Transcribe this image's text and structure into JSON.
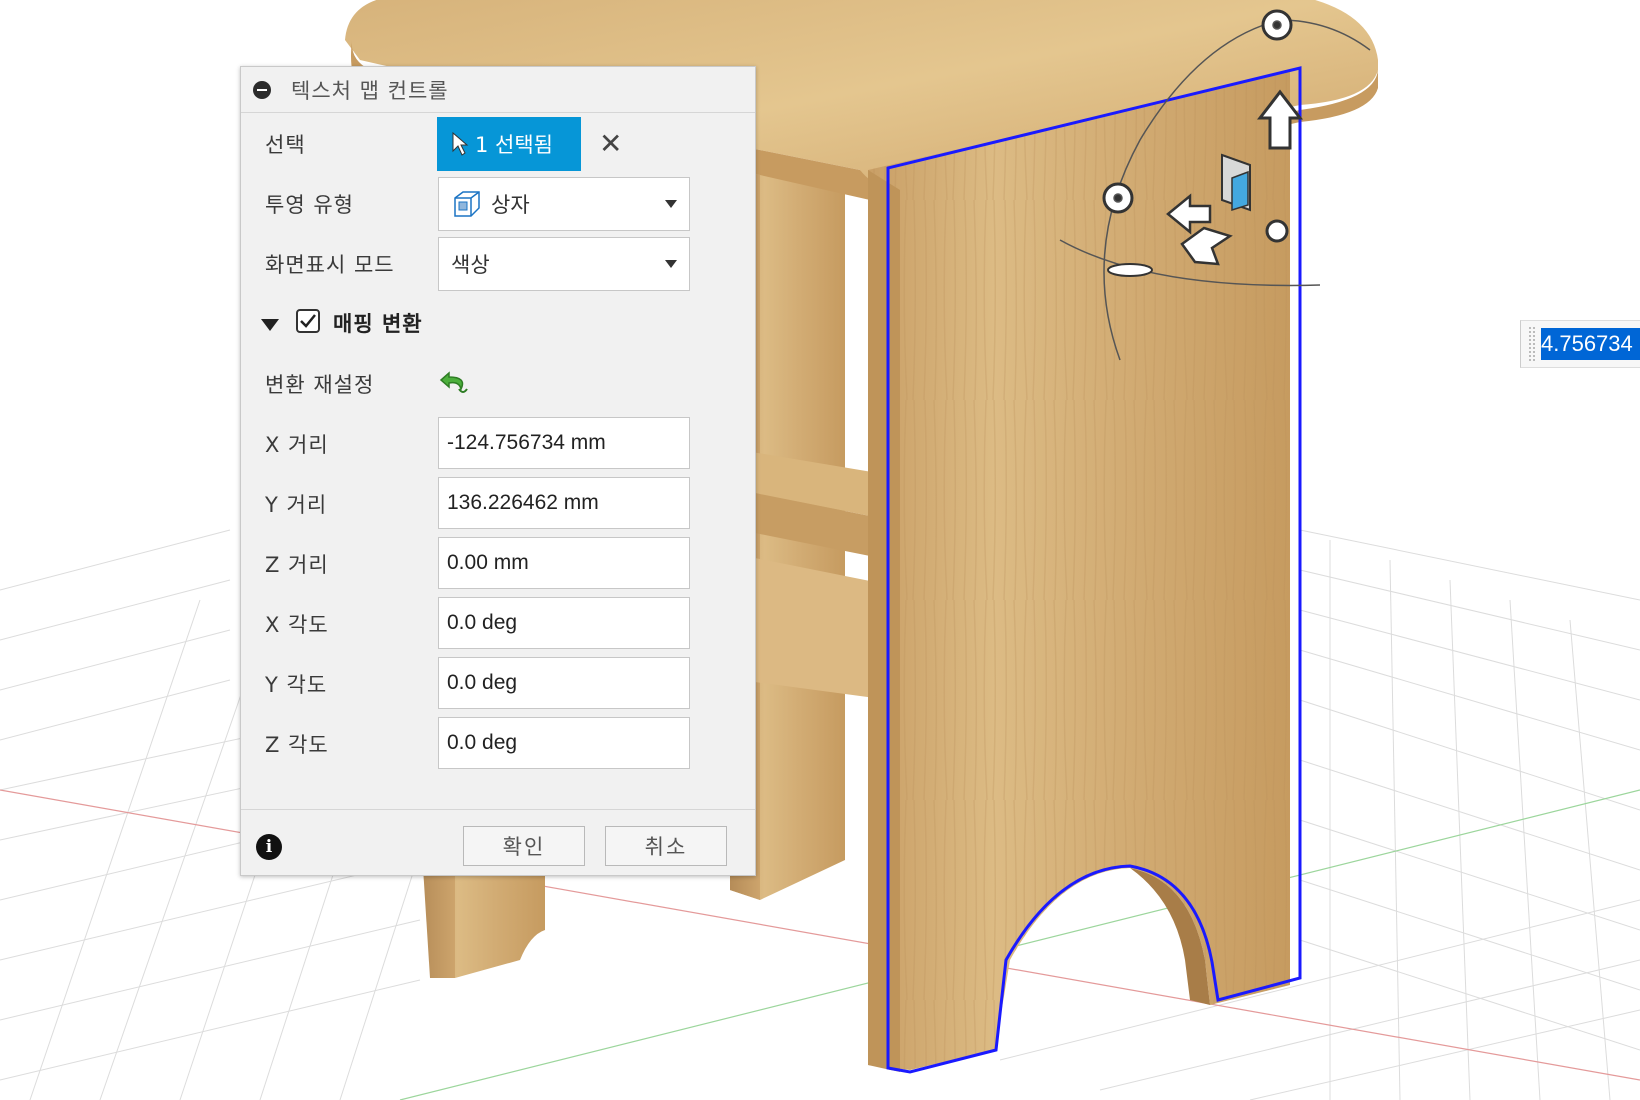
{
  "panel": {
    "title": "텍스처 맵 컨트롤",
    "selection": {
      "label": "선택",
      "button_text": "1 선택됨",
      "clear_symbol": "✕"
    },
    "projection_type": {
      "label": "투영 유형",
      "value": "상자"
    },
    "display_mode": {
      "label": "화면표시 모드",
      "value": "색상"
    },
    "mapping_transform": {
      "label": "매핑 변환",
      "checked": true
    },
    "reset_transform": {
      "label": "변환 재설정"
    },
    "fields": [
      {
        "label": "X 거리",
        "value": "-124.756734 mm"
      },
      {
        "label": "Y 거리",
        "value": "136.226462 mm"
      },
      {
        "label": "Z 거리",
        "value": "0.00 mm"
      },
      {
        "label": "X 각도",
        "value": "0.0 deg"
      },
      {
        "label": "Y 각도",
        "value": "0.0 deg"
      },
      {
        "label": "Z 각도",
        "value": "0.0 deg"
      }
    ],
    "ok_label": "확인",
    "cancel_label": "취소"
  },
  "value_input": {
    "value": "4.756734"
  },
  "colors": {
    "accent": "#0696d7",
    "selection_outline": "#1a1aff",
    "wood_light": "#e2c48c",
    "wood_dark": "#c49a62",
    "grid_line": "#d8d8d8",
    "axis_red": "#e07a7a",
    "axis_green": "#7ac87a"
  }
}
